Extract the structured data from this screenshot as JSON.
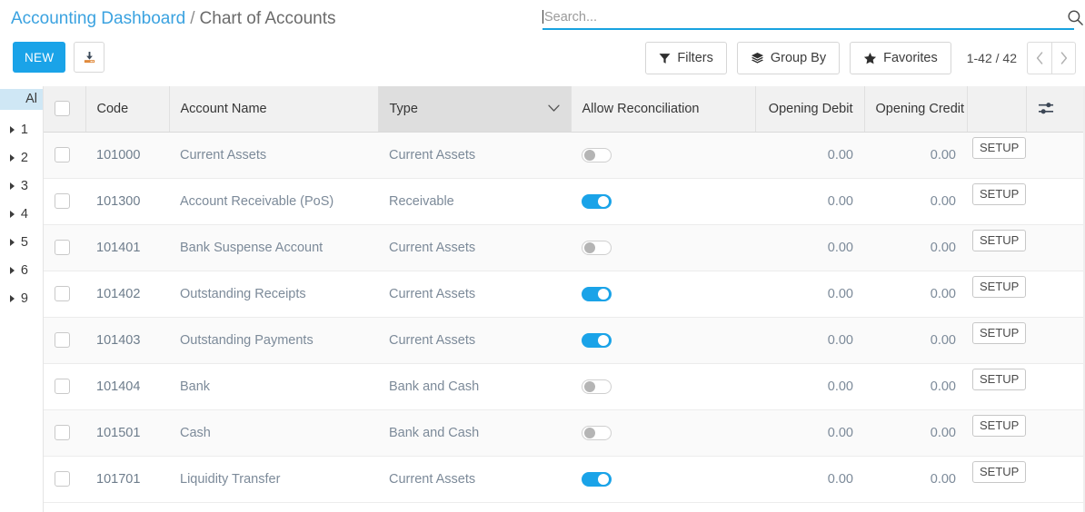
{
  "breadcrumb": {
    "parent": "Accounting Dashboard",
    "separator": "/",
    "current": "Chart of Accounts"
  },
  "toolbar": {
    "new_label": "NEW",
    "export_icon": "download-icon"
  },
  "search": {
    "placeholder": "Search...",
    "value": "",
    "icon": "search-icon",
    "accent_color": "#17a2e0"
  },
  "filters": {
    "filters_label": "Filters",
    "group_by_label": "Group By",
    "favorites_label": "Favorites",
    "filters_icon": "funnel-icon",
    "group_by_icon": "layers-icon",
    "favorites_icon": "star-icon"
  },
  "pager": {
    "range": "1-42 / 42",
    "prev_icon": "chevron-left-icon",
    "next_icon": "chevron-right-icon"
  },
  "sidebar": {
    "all_label": "Al",
    "nodes": [
      {
        "label": "1"
      },
      {
        "label": "2"
      },
      {
        "label": "3"
      },
      {
        "label": "4"
      },
      {
        "label": "5"
      },
      {
        "label": "6"
      },
      {
        "label": "9"
      }
    ]
  },
  "table": {
    "columns": [
      {
        "key": "code",
        "label": "Code",
        "align": "left",
        "sorted": false
      },
      {
        "key": "name",
        "label": "Account Name",
        "align": "left",
        "sorted": false
      },
      {
        "key": "type",
        "label": "Type",
        "align": "left",
        "sorted": true
      },
      {
        "key": "allow",
        "label": "Allow Reconciliation",
        "align": "left",
        "sorted": false
      },
      {
        "key": "debit",
        "label": "Opening Debit",
        "align": "right",
        "sorted": false
      },
      {
        "key": "credit",
        "label": "Opening Credit",
        "align": "right",
        "sorted": false
      }
    ],
    "optional_columns_icon": "sliders-icon",
    "sort_icon": "chevron-down-icon",
    "setup_label": "SETUP",
    "rows": [
      {
        "code": "101000",
        "name": "Current Assets",
        "type": "Current Assets",
        "allow": false,
        "debit": "0.00",
        "credit": "0.00",
        "setup": "SETUP"
      },
      {
        "code": "101300",
        "name": "Account Receivable (PoS)",
        "type": "Receivable",
        "allow": true,
        "debit": "0.00",
        "credit": "0.00",
        "setup": "SETUP"
      },
      {
        "code": "101401",
        "name": "Bank Suspense Account",
        "type": "Current Assets",
        "allow": false,
        "debit": "0.00",
        "credit": "0.00",
        "setup": "SETUP"
      },
      {
        "code": "101402",
        "name": "Outstanding Receipts",
        "type": "Current Assets",
        "allow": true,
        "debit": "0.00",
        "credit": "0.00",
        "setup": "SETUP"
      },
      {
        "code": "101403",
        "name": "Outstanding Payments",
        "type": "Current Assets",
        "allow": true,
        "debit": "0.00",
        "credit": "0.00",
        "setup": "SETUP"
      },
      {
        "code": "101404",
        "name": "Bank",
        "type": "Bank and Cash",
        "allow": false,
        "debit": "0.00",
        "credit": "0.00",
        "setup": "SETUP"
      },
      {
        "code": "101501",
        "name": "Cash",
        "type": "Bank and Cash",
        "allow": false,
        "debit": "0.00",
        "credit": "0.00",
        "setup": "SETUP"
      },
      {
        "code": "101701",
        "name": "Liquidity Transfer",
        "type": "Current Assets",
        "allow": true,
        "debit": "0.00",
        "credit": "0.00",
        "setup": "SETUP"
      }
    ]
  },
  "colors": {
    "accent": "#1aa3e8",
    "link": "#3aa2e0",
    "sidebar_selected": "#cfe7f5",
    "header_bg": "#f1f1f1",
    "header_sorted_bg": "#dedede"
  }
}
